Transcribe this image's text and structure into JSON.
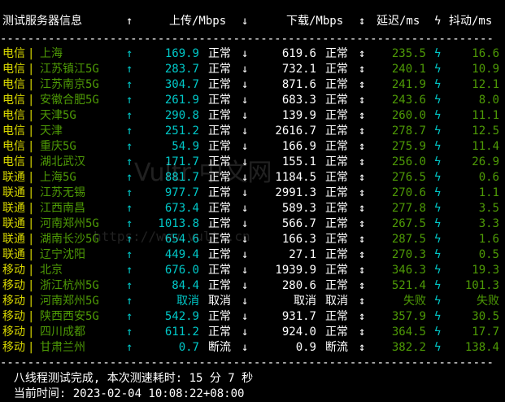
{
  "header": {
    "name": "测试服务器信息",
    "up_arrow": "↑",
    "upload": "上传/Mbps",
    "down_arrow": "↓",
    "download": "下载/Mbps",
    "updown_arrow": "↕",
    "latency": "延迟/ms",
    "bolt": "ϟ",
    "jitter": "抖动/ms"
  },
  "separator": "------------------------------------------------------------------------",
  "rows": [
    {
      "isp": "电信",
      "bar": "|",
      "node": "上海",
      "up_arrow": "↑",
      "up": "169.9",
      "up_status": "正常",
      "down_arrow": "↓",
      "down": "619.6",
      "down_status": "正常",
      "ud": "↕",
      "latency": "235.5",
      "bolt": "ϟ",
      "jitter": "16.6"
    },
    {
      "isp": "电信",
      "bar": "|",
      "node": "江苏镇江5G",
      "up_arrow": "↑",
      "up": "283.7",
      "up_status": "正常",
      "down_arrow": "↓",
      "down": "732.1",
      "down_status": "正常",
      "ud": "↕",
      "latency": "240.1",
      "bolt": "ϟ",
      "jitter": "10.9"
    },
    {
      "isp": "电信",
      "bar": "|",
      "node": "江苏南京5G",
      "up_arrow": "↑",
      "up": "304.7",
      "up_status": "正常",
      "down_arrow": "↓",
      "down": "871.6",
      "down_status": "正常",
      "ud": "↕",
      "latency": "241.9",
      "bolt": "ϟ",
      "jitter": "12.1"
    },
    {
      "isp": "电信",
      "bar": "|",
      "node": "安徽合肥5G",
      "up_arrow": "↑",
      "up": "261.9",
      "up_status": "正常",
      "down_arrow": "↓",
      "down": "683.3",
      "down_status": "正常",
      "ud": "↕",
      "latency": "243.6",
      "bolt": "ϟ",
      "jitter": "8.0"
    },
    {
      "isp": "电信",
      "bar": "|",
      "node": "天津5G",
      "up_arrow": "↑",
      "up": "290.8",
      "up_status": "正常",
      "down_arrow": "↓",
      "down": "139.9",
      "down_status": "正常",
      "ud": "↕",
      "latency": "260.0",
      "bolt": "ϟ",
      "jitter": "11.1"
    },
    {
      "isp": "电信",
      "bar": "|",
      "node": "天津",
      "up_arrow": "↑",
      "up": "251.2",
      "up_status": "正常",
      "down_arrow": "↓",
      "down": "2616.7",
      "down_status": "正常",
      "ud": "↕",
      "latency": "278.7",
      "bolt": "ϟ",
      "jitter": "12.5"
    },
    {
      "isp": "电信",
      "bar": "|",
      "node": "重庆5G",
      "up_arrow": "↑",
      "up": "54.9",
      "up_status": "正常",
      "down_arrow": "↓",
      "down": "166.9",
      "down_status": "正常",
      "ud": "↕",
      "latency": "275.9",
      "bolt": "ϟ",
      "jitter": "11.4"
    },
    {
      "isp": "电信",
      "bar": "|",
      "node": "湖北武汉",
      "up_arrow": "↑",
      "up": "171.7",
      "up_status": "正常",
      "down_arrow": "↓",
      "down": "155.1",
      "down_status": "正常",
      "ud": "↕",
      "latency": "256.0",
      "bolt": "ϟ",
      "jitter": "26.9"
    },
    {
      "isp": "联通",
      "bar": "|",
      "node": "上海5G",
      "up_arrow": "↑",
      "up": "881.7",
      "up_status": "正常",
      "down_arrow": "↓",
      "down": "1184.5",
      "down_status": "正常",
      "ud": "↕",
      "latency": "276.5",
      "bolt": "ϟ",
      "jitter": "0.6"
    },
    {
      "isp": "联通",
      "bar": "|",
      "node": "江苏无锡",
      "up_arrow": "↑",
      "up": "977.7",
      "up_status": "正常",
      "down_arrow": "↓",
      "down": "2991.3",
      "down_status": "正常",
      "ud": "↕",
      "latency": "270.6",
      "bolt": "ϟ",
      "jitter": "1.1"
    },
    {
      "isp": "联通",
      "bar": "|",
      "node": "江西南昌",
      "up_arrow": "↑",
      "up": "673.4",
      "up_status": "正常",
      "down_arrow": "↓",
      "down": "589.3",
      "down_status": "正常",
      "ud": "↕",
      "latency": "277.8",
      "bolt": "ϟ",
      "jitter": "3.5"
    },
    {
      "isp": "联通",
      "bar": "|",
      "node": "河南郑州5G",
      "up_arrow": "↑",
      "up": "1013.8",
      "up_status": "正常",
      "down_arrow": "↓",
      "down": "566.7",
      "down_status": "正常",
      "ud": "↕",
      "latency": "267.5",
      "bolt": "ϟ",
      "jitter": "3.3"
    },
    {
      "isp": "联通",
      "bar": "|",
      "node": "湖南长沙5G",
      "up_arrow": "↑",
      "up": "654.6",
      "up_status": "正常",
      "down_arrow": "↓",
      "down": "166.3",
      "down_status": "正常",
      "ud": "↕",
      "latency": "287.5",
      "bolt": "ϟ",
      "jitter": "1.6"
    },
    {
      "isp": "联通",
      "bar": "|",
      "node": "辽宁沈阳",
      "up_arrow": "↑",
      "up": "449.4",
      "up_status": "正常",
      "down_arrow": "↓",
      "down": "27.1",
      "down_status": "正常",
      "ud": "↕",
      "latency": "270.3",
      "bolt": "ϟ",
      "jitter": "0.5"
    },
    {
      "isp": "移动",
      "bar": "|",
      "node": "北京",
      "up_arrow": "↑",
      "up": "676.0",
      "up_status": "正常",
      "down_arrow": "↓",
      "down": "1939.9",
      "down_status": "正常",
      "ud": "↕",
      "latency": "346.3",
      "bolt": "ϟ",
      "jitter": "19.3"
    },
    {
      "isp": "移动",
      "bar": "|",
      "node": "浙江杭州5G",
      "up_arrow": "↑",
      "up": "84.4",
      "up_status": "正常",
      "down_arrow": "↓",
      "down": "280.6",
      "down_status": "正常",
      "ud": "↕",
      "latency": "521.4",
      "bolt": "ϟ",
      "jitter": "101.3"
    },
    {
      "isp": "移动",
      "bar": "|",
      "node": "河南郑州5G",
      "up_arrow": "↑",
      "up": "取消",
      "up_status": "取消",
      "down_arrow": "↓",
      "down": "取消",
      "down_status": "取消",
      "ud": "↕",
      "latency": "失败",
      "bolt": "ϟ",
      "jitter": "失败"
    },
    {
      "isp": "移动",
      "bar": "|",
      "node": "陕西西安5G",
      "up_arrow": "↑",
      "up": "542.9",
      "up_status": "正常",
      "down_arrow": "↓",
      "down": "931.7",
      "down_status": "正常",
      "ud": "↕",
      "latency": "357.9",
      "bolt": "ϟ",
      "jitter": "30.5"
    },
    {
      "isp": "移动",
      "bar": "|",
      "node": "四川成都",
      "up_arrow": "↑",
      "up": "611.2",
      "up_status": "正常",
      "down_arrow": "↓",
      "down": "924.0",
      "down_status": "正常",
      "ud": "↕",
      "latency": "364.5",
      "bolt": "ϟ",
      "jitter": "17.7"
    },
    {
      "isp": "移动",
      "bar": "|",
      "node": "甘肃兰州",
      "up_arrow": "↑",
      "up": "0.7",
      "up_status": "断流",
      "down_arrow": "↓",
      "down": "0.9",
      "down_status": "断流",
      "ud": "↕",
      "latency": "382.2",
      "bolt": "ϟ",
      "jitter": "138.4"
    }
  ],
  "footer": {
    "line1": "  八线程测试完成, 本次测速耗时: 15 分 7 秒",
    "line2": "  当前时间: 2023-02-04 10:08:22+08:00"
  },
  "watermark": {
    "text1": "Vultr 中文网",
    "text2": "https://www.vultr.cn"
  },
  "colors": {
    "isp": "#d7d700",
    "node": "#4e9a06",
    "value": "#00c8c8",
    "status": "#ffffff",
    "background": "#000000"
  }
}
